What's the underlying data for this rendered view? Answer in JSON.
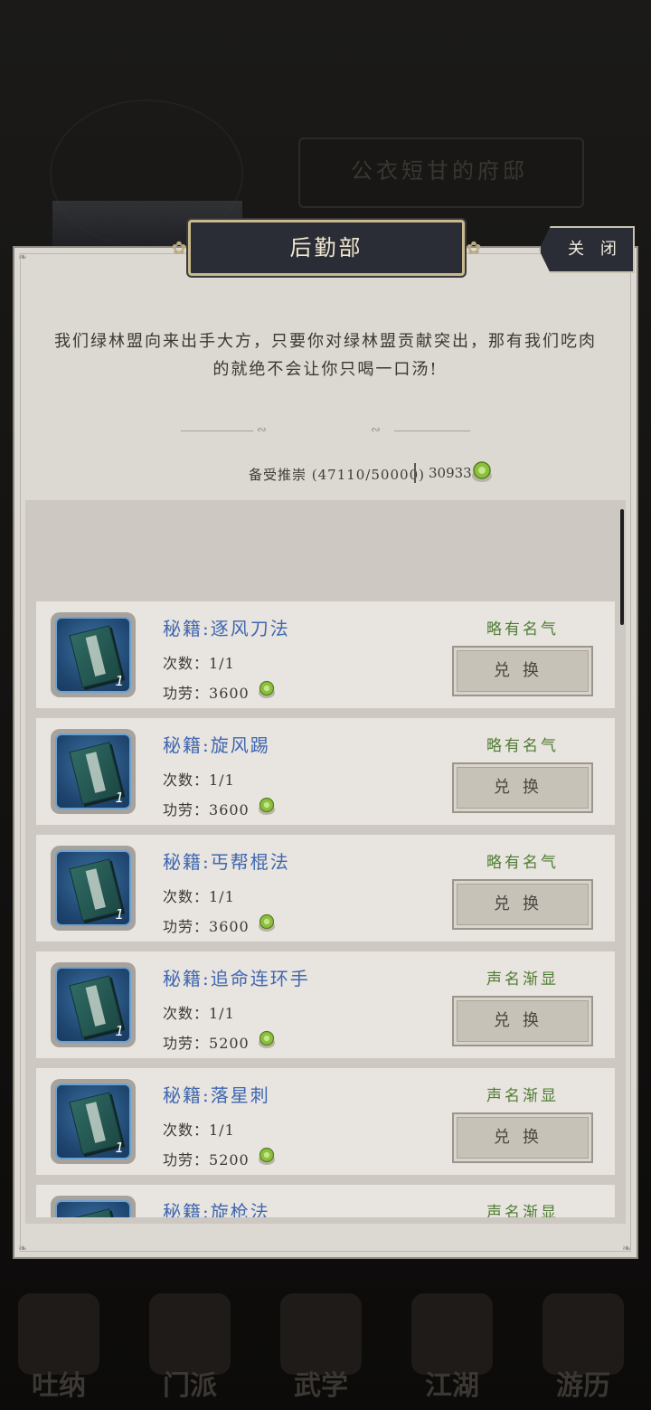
{
  "background": {
    "title": "公衣短甘的府邸",
    "nav": [
      "吐纳",
      "门派",
      "武学",
      "江湖",
      "游历"
    ]
  },
  "dialog": {
    "title": "后勤部",
    "close_label": "关 闭",
    "description": "我们绿林盟向来出手大方，只要你对绿林盟贡献突出，那有我们吃肉的就绝不会让你只喝一口汤!",
    "reputation_label": "备受推崇 (47110/50000)",
    "currency_value": "30933"
  },
  "items": [
    {
      "name": "秘籍:逐风刀法",
      "count": "次数：1/1",
      "cost_label": "功劳：",
      "cost": "3600",
      "rank": "略有名气",
      "button": "兑换",
      "qty": "1"
    },
    {
      "name": "秘籍:旋风踢",
      "count": "次数：1/1",
      "cost_label": "功劳：",
      "cost": "3600",
      "rank": "略有名气",
      "button": "兑换",
      "qty": "1"
    },
    {
      "name": "秘籍:丐帮棍法",
      "count": "次数：1/1",
      "cost_label": "功劳：",
      "cost": "3600",
      "rank": "略有名气",
      "button": "兑换",
      "qty": "1"
    },
    {
      "name": "秘籍:追命连环手",
      "count": "次数：1/1",
      "cost_label": "功劳：",
      "cost": "5200",
      "rank": "声名渐显",
      "button": "兑换",
      "qty": "1"
    },
    {
      "name": "秘籍:落星刺",
      "count": "次数：1/1",
      "cost_label": "功劳：",
      "cost": "5200",
      "rank": "声名渐显",
      "button": "兑换",
      "qty": "1"
    },
    {
      "name": "秘籍:旋枪法",
      "rank": "声名渐显"
    }
  ],
  "colors": {
    "panel": "#dcd8d2",
    "title_plate": "#2a2d36",
    "item_name": "#3f67b0",
    "rank": "#4f7d32",
    "coin": "#8bbf3c"
  }
}
